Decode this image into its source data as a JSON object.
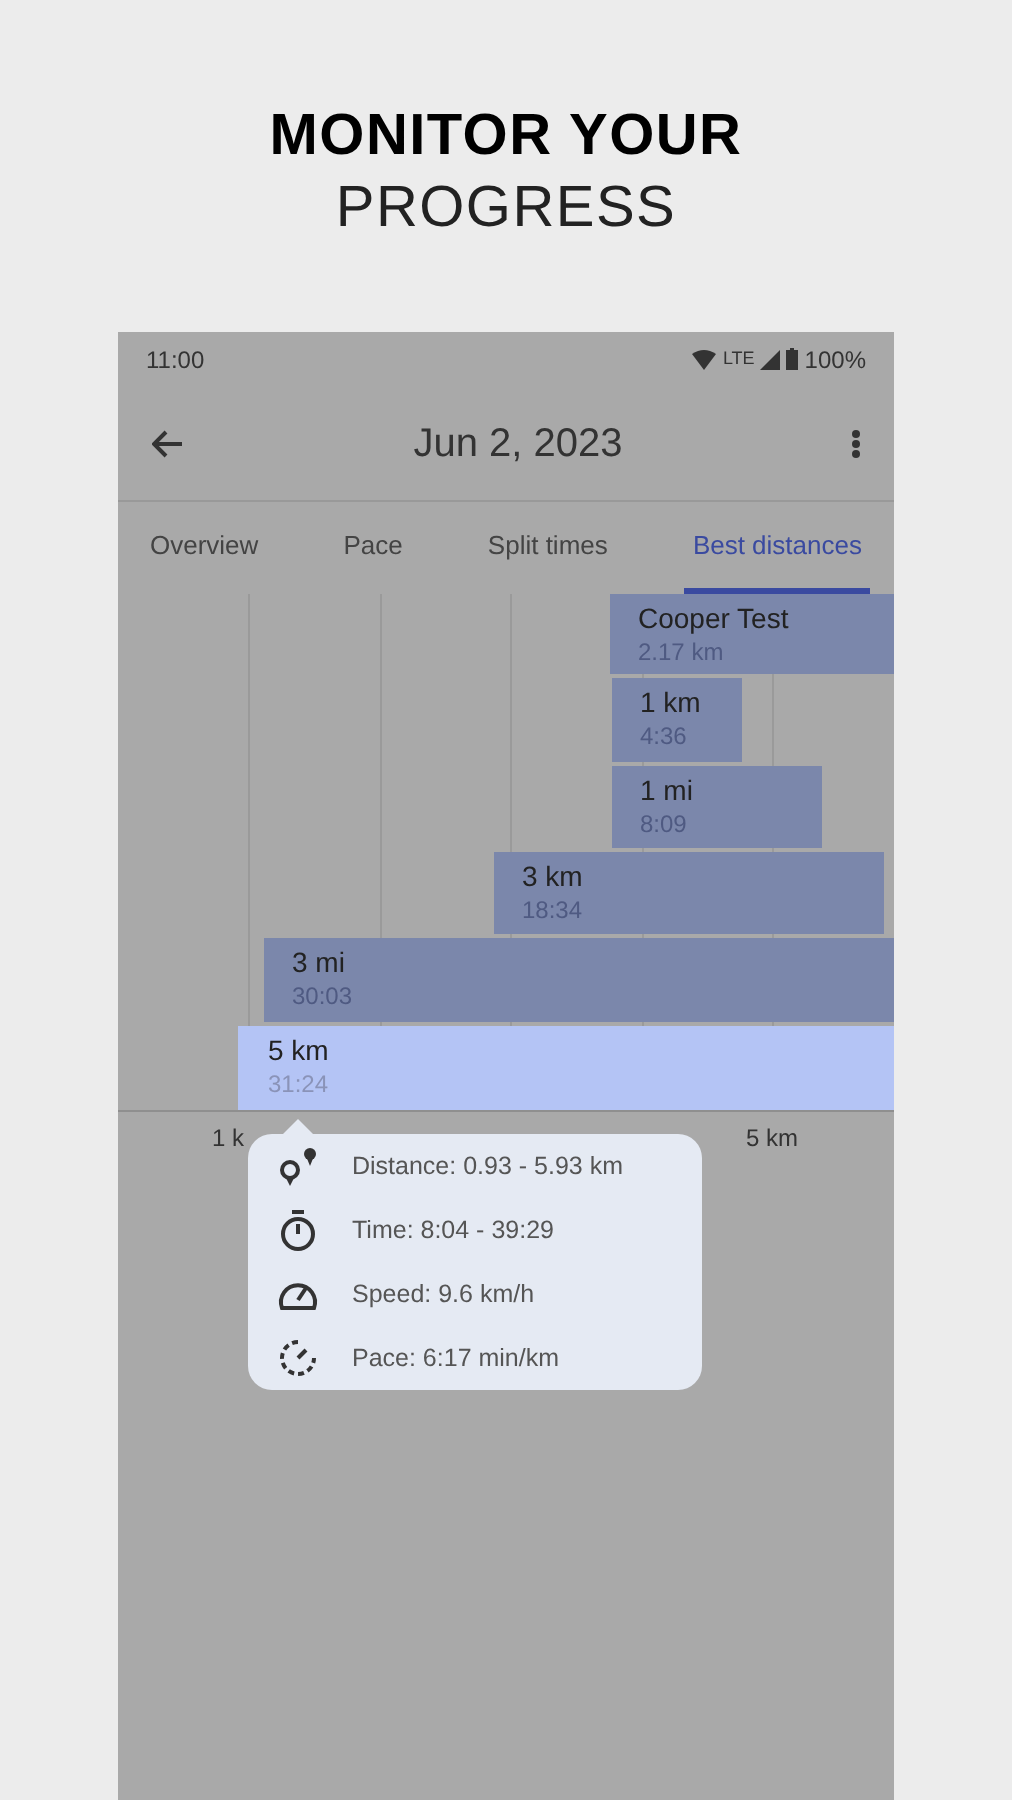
{
  "headline": {
    "line_1": "MONITOR YOUR",
    "line_2": "PROGRESS"
  },
  "status_bar": {
    "time": "11:00",
    "network": "LTE",
    "battery": "100%"
  },
  "app_bar": {
    "title": "Jun 2, 2023"
  },
  "tabs": [
    {
      "label": "Overview",
      "selected": false
    },
    {
      "label": "Pace",
      "selected": false
    },
    {
      "label": "Split times",
      "selected": false
    },
    {
      "label": "Best distances",
      "selected": true
    }
  ],
  "bars": [
    {
      "name": "Cooper Test",
      "value": "2.17 km",
      "selected": false
    },
    {
      "name": "1 km",
      "value": "4:36",
      "selected": false
    },
    {
      "name": "1 mi",
      "value": "8:09",
      "selected": false
    },
    {
      "name": "3 km",
      "value": "18:34",
      "selected": false
    },
    {
      "name": "3 mi",
      "value": "30:03",
      "selected": false
    },
    {
      "name": "5 km",
      "value": "31:24",
      "selected": true
    }
  ],
  "axis_labels": [
    "1 k",
    "5 km"
  ],
  "tooltip": [
    {
      "kind": "distance",
      "text": "Distance: 0.93 - 5.93 km"
    },
    {
      "kind": "time",
      "text": "Time: 8:04 - 39:29"
    },
    {
      "kind": "speed",
      "text": "Speed: 9.6 km/h"
    },
    {
      "kind": "pace",
      "text": "Pace: 6:17 min/km"
    }
  ]
}
